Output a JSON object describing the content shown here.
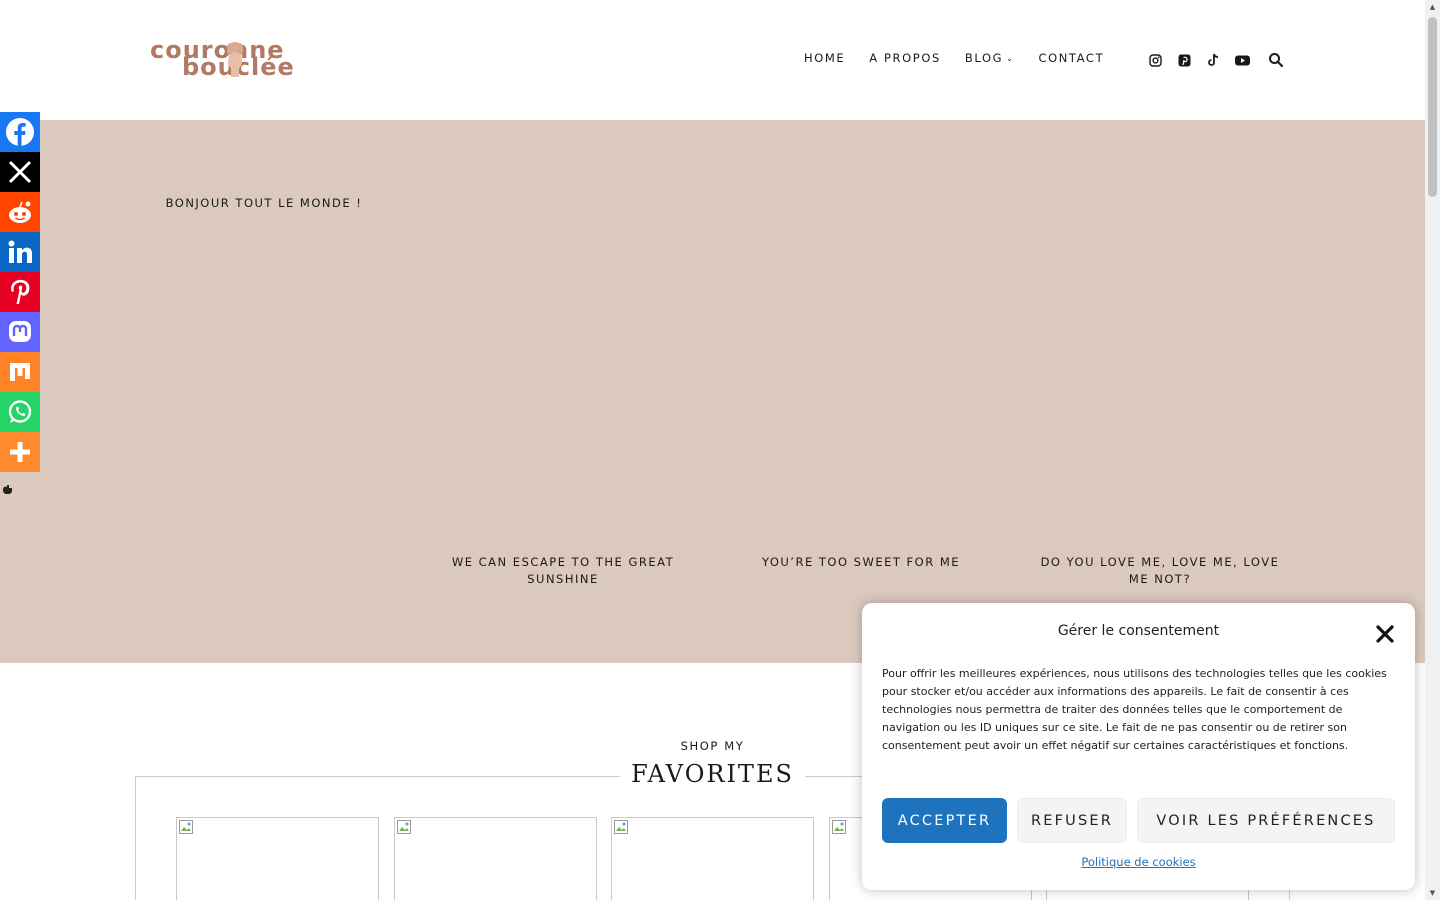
{
  "logo": {
    "line1": "couronne",
    "line2": "bouclée",
    "color": "#b07a63"
  },
  "nav": {
    "items": [
      {
        "label": "HOME"
      },
      {
        "label": "A PROPOS"
      },
      {
        "label": "BLOG",
        "has_dropdown": true
      },
      {
        "label": "CONTACT"
      }
    ],
    "social_icons": [
      "instagram-icon",
      "pinterest-icon",
      "tiktok-icon",
      "youtube-icon"
    ],
    "search_icon": "search-icon"
  },
  "hero": {
    "bg_color": "#dbc9be",
    "featured_title": "BONJOUR TOUT LE MONDE !",
    "posts": [
      {
        "title": "WE CAN ESCAPE TO THE GREAT SUNSHINE"
      },
      {
        "title": "YOU’RE TOO SWEET FOR ME"
      },
      {
        "title": "DO YOU LOVE ME, LOVE ME, LOVE ME NOT?"
      }
    ]
  },
  "share_bar": {
    "items": [
      {
        "name": "facebook-icon",
        "color": "#1877f2"
      },
      {
        "name": "x-icon",
        "color": "#000000"
      },
      {
        "name": "reddit-icon",
        "color": "#ff4500"
      },
      {
        "name": "linkedin-icon",
        "color": "#0a66c2"
      },
      {
        "name": "pinterest-icon",
        "color": "#e60023"
      },
      {
        "name": "mastodon-icon",
        "color": "#6364ff"
      },
      {
        "name": "mix-icon",
        "color": "#ff8226"
      },
      {
        "name": "whatsapp-icon",
        "color": "#25d366"
      },
      {
        "name": "more-icon",
        "color": "#ff8b2e"
      }
    ]
  },
  "shop": {
    "kicker": "SHOP MY",
    "title": "FAVORITES"
  },
  "cookie": {
    "title": "Gérer le consentement",
    "message": "Pour offrir les meilleures expériences, nous utilisons des technologies telles que les cookies pour stocker et/ou accéder aux informations des appareils. Le fait de consentir à ces technologies nous permettra de traiter des données telles que le comportement de navigation ou les ID uniques sur ce site. Le fait de ne pas consentir ou de retirer son consentement peut avoir un effet négatif sur certaines caractéristiques et fonctions.",
    "accept": "ACCEPTER",
    "refuse": "REFUSER",
    "preferences": "VOIR LES PRÉFÉRENCES",
    "policy": "Politique de cookies",
    "accent": "#1e73be"
  }
}
